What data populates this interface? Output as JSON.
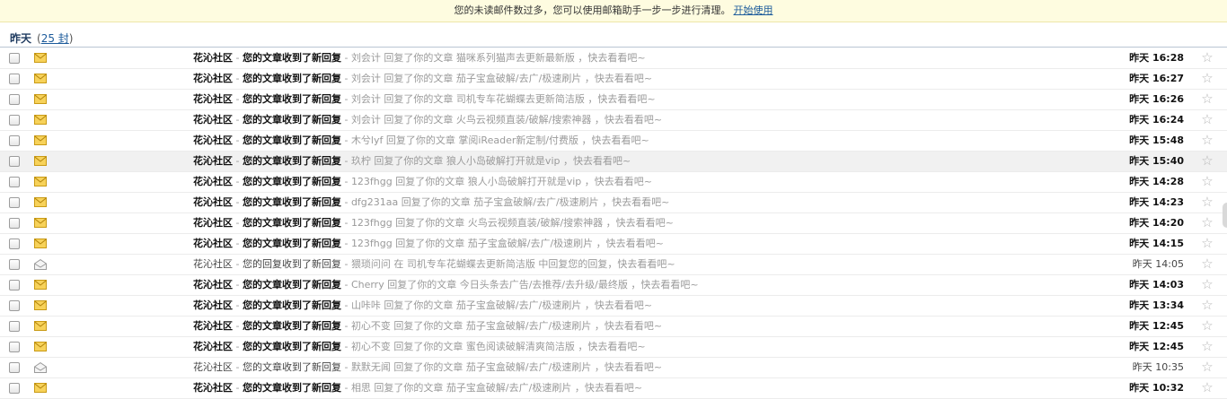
{
  "notice": {
    "text": "您的未读邮件数过多，您可以使用邮箱助手一步一步进行清理。",
    "link": "开始使用"
  },
  "group": {
    "title": "昨天",
    "count_open": "(",
    "count": "25 封",
    "count_close": ")"
  },
  "messages": [
    {
      "sender": "花沁社区",
      "subject": "您的文章收到了新回复",
      "sep": " - ",
      "summary": "刘会计 回复了你的文章 猫咪系列猫声去更新最新版 ，快去看看吧~",
      "time": "昨天 16:28",
      "unread": true
    },
    {
      "sender": "花沁社区",
      "subject": "您的文章收到了新回复",
      "sep": " - ",
      "summary": "刘会计 回复了你的文章 茄子宝盒破解/去广/极速刷片 ，快去看看吧~",
      "time": "昨天 16:27",
      "unread": true
    },
    {
      "sender": "花沁社区",
      "subject": "您的文章收到了新回复",
      "sep": " - ",
      "summary": "刘会计 回复了你的文章 司机专车花蝴蝶去更新简洁版 ，快去看看吧~",
      "time": "昨天 16:26",
      "unread": true
    },
    {
      "sender": "花沁社区",
      "subject": "您的文章收到了新回复",
      "sep": " - ",
      "summary": "刘会计 回复了你的文章 火鸟云视频直装/破解/搜索神器 ，快去看看吧~",
      "time": "昨天 16:24",
      "unread": true
    },
    {
      "sender": "花沁社区",
      "subject": "您的文章收到了新回复",
      "sep": " - ",
      "summary": "木兮lyf 回复了你的文章 掌阅iReader新定制/付费版 ，快去看看吧~",
      "time": "昨天 15:48",
      "unread": true
    },
    {
      "sender": "花沁社区",
      "subject": "您的文章收到了新回复",
      "sep": " - ",
      "summary": "玖柠 回复了你的文章 狼人小岛破解打开就是vip ，快去看看吧~",
      "time": "昨天 15:40",
      "unread": true
    },
    {
      "sender": "花沁社区",
      "subject": "您的文章收到了新回复",
      "sep": " - ",
      "summary": "123fhgg 回复了你的文章 狼人小岛破解打开就是vip ，快去看看吧~",
      "time": "昨天 14:28",
      "unread": true
    },
    {
      "sender": "花沁社区",
      "subject": "您的文章收到了新回复",
      "sep": " - ",
      "summary": "dfg231aa 回复了你的文章 茄子宝盒破解/去广/极速刷片 ，快去看看吧~",
      "time": "昨天 14:23",
      "unread": true
    },
    {
      "sender": "花沁社区",
      "subject": "您的文章收到了新回复",
      "sep": " - ",
      "summary": "123fhgg 回复了你的文章 火鸟云视频直装/破解/搜索神器 ，快去看看吧~",
      "time": "昨天 14:20",
      "unread": true
    },
    {
      "sender": "花沁社区",
      "subject": "您的文章收到了新回复",
      "sep": " - ",
      "summary": "123fhgg 回复了你的文章 茄子宝盒破解/去广/极速刷片 ，快去看看吧~",
      "time": "昨天 14:15",
      "unread": true
    },
    {
      "sender": "花沁社区",
      "subject": "您的回复收到了新回复",
      "sep": " - ",
      "summary": "猥琐问问 在 司机专车花蝴蝶去更新简洁版 中回复您的回复，快去看看吧~",
      "time": "昨天 14:05",
      "unread": false
    },
    {
      "sender": "花沁社区",
      "subject": "您的文章收到了新回复",
      "sep": " - ",
      "summary": "Cherry 回复了你的文章 今日头条去广告/去推荐/去升级/最终版 ，快去看看吧~",
      "time": "昨天 14:03",
      "unread": true
    },
    {
      "sender": "花沁社区",
      "subject": "您的文章收到了新回复",
      "sep": " - ",
      "summary": "山咔咔 回复了你的文章 茄子宝盒破解/去广/极速刷片 ，快去看看吧~",
      "time": "昨天 13:34",
      "unread": true
    },
    {
      "sender": "花沁社区",
      "subject": "您的文章收到了新回复",
      "sep": " - ",
      "summary": "初心不变 回复了你的文章 茄子宝盒破解/去广/极速刷片 ，快去看看吧~",
      "time": "昨天 12:45",
      "unread": true
    },
    {
      "sender": "花沁社区",
      "subject": "您的文章收到了新回复",
      "sep": " - ",
      "summary": "初心不变 回复了你的文章 蜜色阅读破解清爽简洁版 ，快去看看吧~",
      "time": "昨天 12:45",
      "unread": true
    },
    {
      "sender": "花沁社区",
      "subject": "您的文章收到了新回复",
      "sep": " - ",
      "summary": "默默无闻 回复了你的文章 茄子宝盒破解/去广/极速刷片 ，快去看看吧~",
      "time": "昨天 10:35",
      "unread": false
    },
    {
      "sender": "花沁社区",
      "subject": "您的文章收到了新回复",
      "sep": " - ",
      "summary": "相思 回复了你的文章 茄子宝盒破解/去广/极速刷片 ，快去看看吧~",
      "time": "昨天 10:32",
      "unread": true
    }
  ],
  "hover_index": 5,
  "icons": {
    "unread": "envelope-closed-icon",
    "read": "envelope-open-icon",
    "star": "star-icon"
  },
  "colors": {
    "notice_bg": "#fefce0",
    "link": "#1c5b9b",
    "envelope": "#f3bf2b"
  }
}
